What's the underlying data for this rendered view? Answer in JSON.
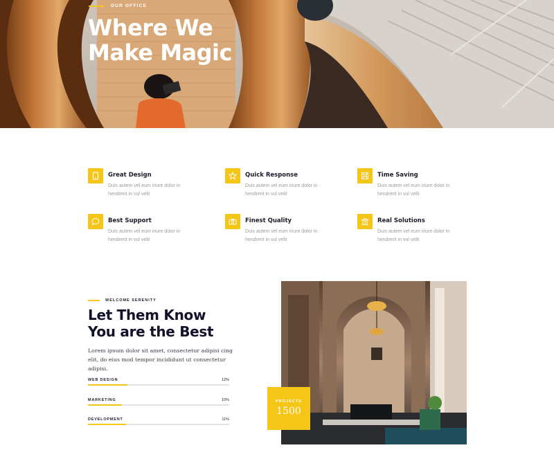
{
  "colors": {
    "accent": "#f5c518",
    "heading": "#12122a",
    "muted": "#9a9aa3"
  },
  "hero": {
    "eyebrow": "OUR OFFICE",
    "title_line1": "Where We",
    "title_line2": "Make Magic"
  },
  "features": [
    {
      "icon": "tablet-icon",
      "title": "Great Design",
      "desc": "Duis autem vel eum iriure dolor in hendrerit in vul velit"
    },
    {
      "icon": "star-icon",
      "title": "Quick Response",
      "desc": "Duis autem vel eum iriure dolor in hendrerit in vul velit"
    },
    {
      "icon": "save-icon",
      "title": "Time Saving",
      "desc": "Duis autem vel eum iriure dolor in hendrerit in vul velit"
    },
    {
      "icon": "chat-bubble-icon",
      "title": "Best Support",
      "desc": "Duis autem vel eum iriure dolor in hendrerit in vul velit"
    },
    {
      "icon": "camera-icon",
      "title": "Finest Quality",
      "desc": "Duis autem vel eum iriure dolor in hendrerit in vul velit"
    },
    {
      "icon": "building-icon",
      "title": "Real Solutions",
      "desc": "Duis autem vel eum iriure dolor in hendrerit in vul velit"
    }
  ],
  "about": {
    "eyebrow": "WELCOME SERENITY",
    "title_line1": "Let Them Know",
    "title_line2": "You are the Best",
    "text": "Lorem ipsum dolor sit amet, consectetur adipisi cing elit, do eius mod tempor incididunt ut consectetur adipisi.",
    "skills": [
      {
        "label": "WEB DESIGN",
        "percent_text": "12%",
        "fill_fraction": 0.28
      },
      {
        "label": "MARKETING",
        "percent_text": "10%",
        "fill_fraction": 0.24
      },
      {
        "label": "DEVELOPMENT",
        "percent_text": "11%",
        "fill_fraction": 0.27
      }
    ],
    "projects": {
      "label": "PROJECTS",
      "value": "1500"
    }
  }
}
